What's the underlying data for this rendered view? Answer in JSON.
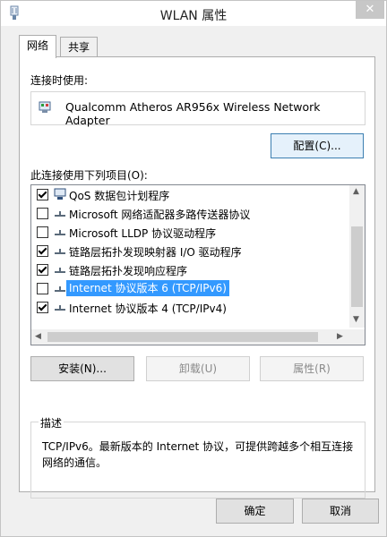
{
  "window": {
    "title": "WLAN 属性",
    "close": "✕"
  },
  "tabs": [
    {
      "label": "网络"
    },
    {
      "label": "共享"
    }
  ],
  "connect_using": {
    "label": "连接时使用:",
    "adapter": "Qualcomm Atheros AR956x Wireless Network Adapter",
    "configure_button": "配置(C)..."
  },
  "items": {
    "label": "此连接使用下列项目(O):",
    "rows": [
      {
        "checked": true,
        "icon": "network-monitor-icon",
        "label": "QoS 数据包计划程序"
      },
      {
        "checked": false,
        "icon": "protocol-icon",
        "label": "Microsoft 网络适配器多路传送器协议"
      },
      {
        "checked": false,
        "icon": "protocol-icon",
        "label": "Microsoft LLDP 协议驱动程序"
      },
      {
        "checked": true,
        "icon": "protocol-icon",
        "label": "链路层拓扑发现映射器 I/O 驱动程序"
      },
      {
        "checked": true,
        "icon": "protocol-icon",
        "label": "链路层拓扑发现响应程序"
      },
      {
        "checked": false,
        "icon": "protocol-icon",
        "label": "Internet 协议版本 6 (TCP/IPv6)",
        "selected": true
      },
      {
        "checked": true,
        "icon": "protocol-icon",
        "label": "Internet 协议版本 4 (TCP/IPv4)"
      }
    ]
  },
  "actions": {
    "install": "安装(N)...",
    "uninstall": "卸载(U)",
    "properties": "属性(R)"
  },
  "description": {
    "title": "描述",
    "text": "TCP/IPv6。最新版本的 Internet 协议，可提供跨越多个相互连接网络的通信。"
  },
  "footer": {
    "ok": "确定",
    "cancel": "取消"
  },
  "colors": {
    "selection": "#3399ff",
    "focus_border": "#3c7fb1"
  }
}
